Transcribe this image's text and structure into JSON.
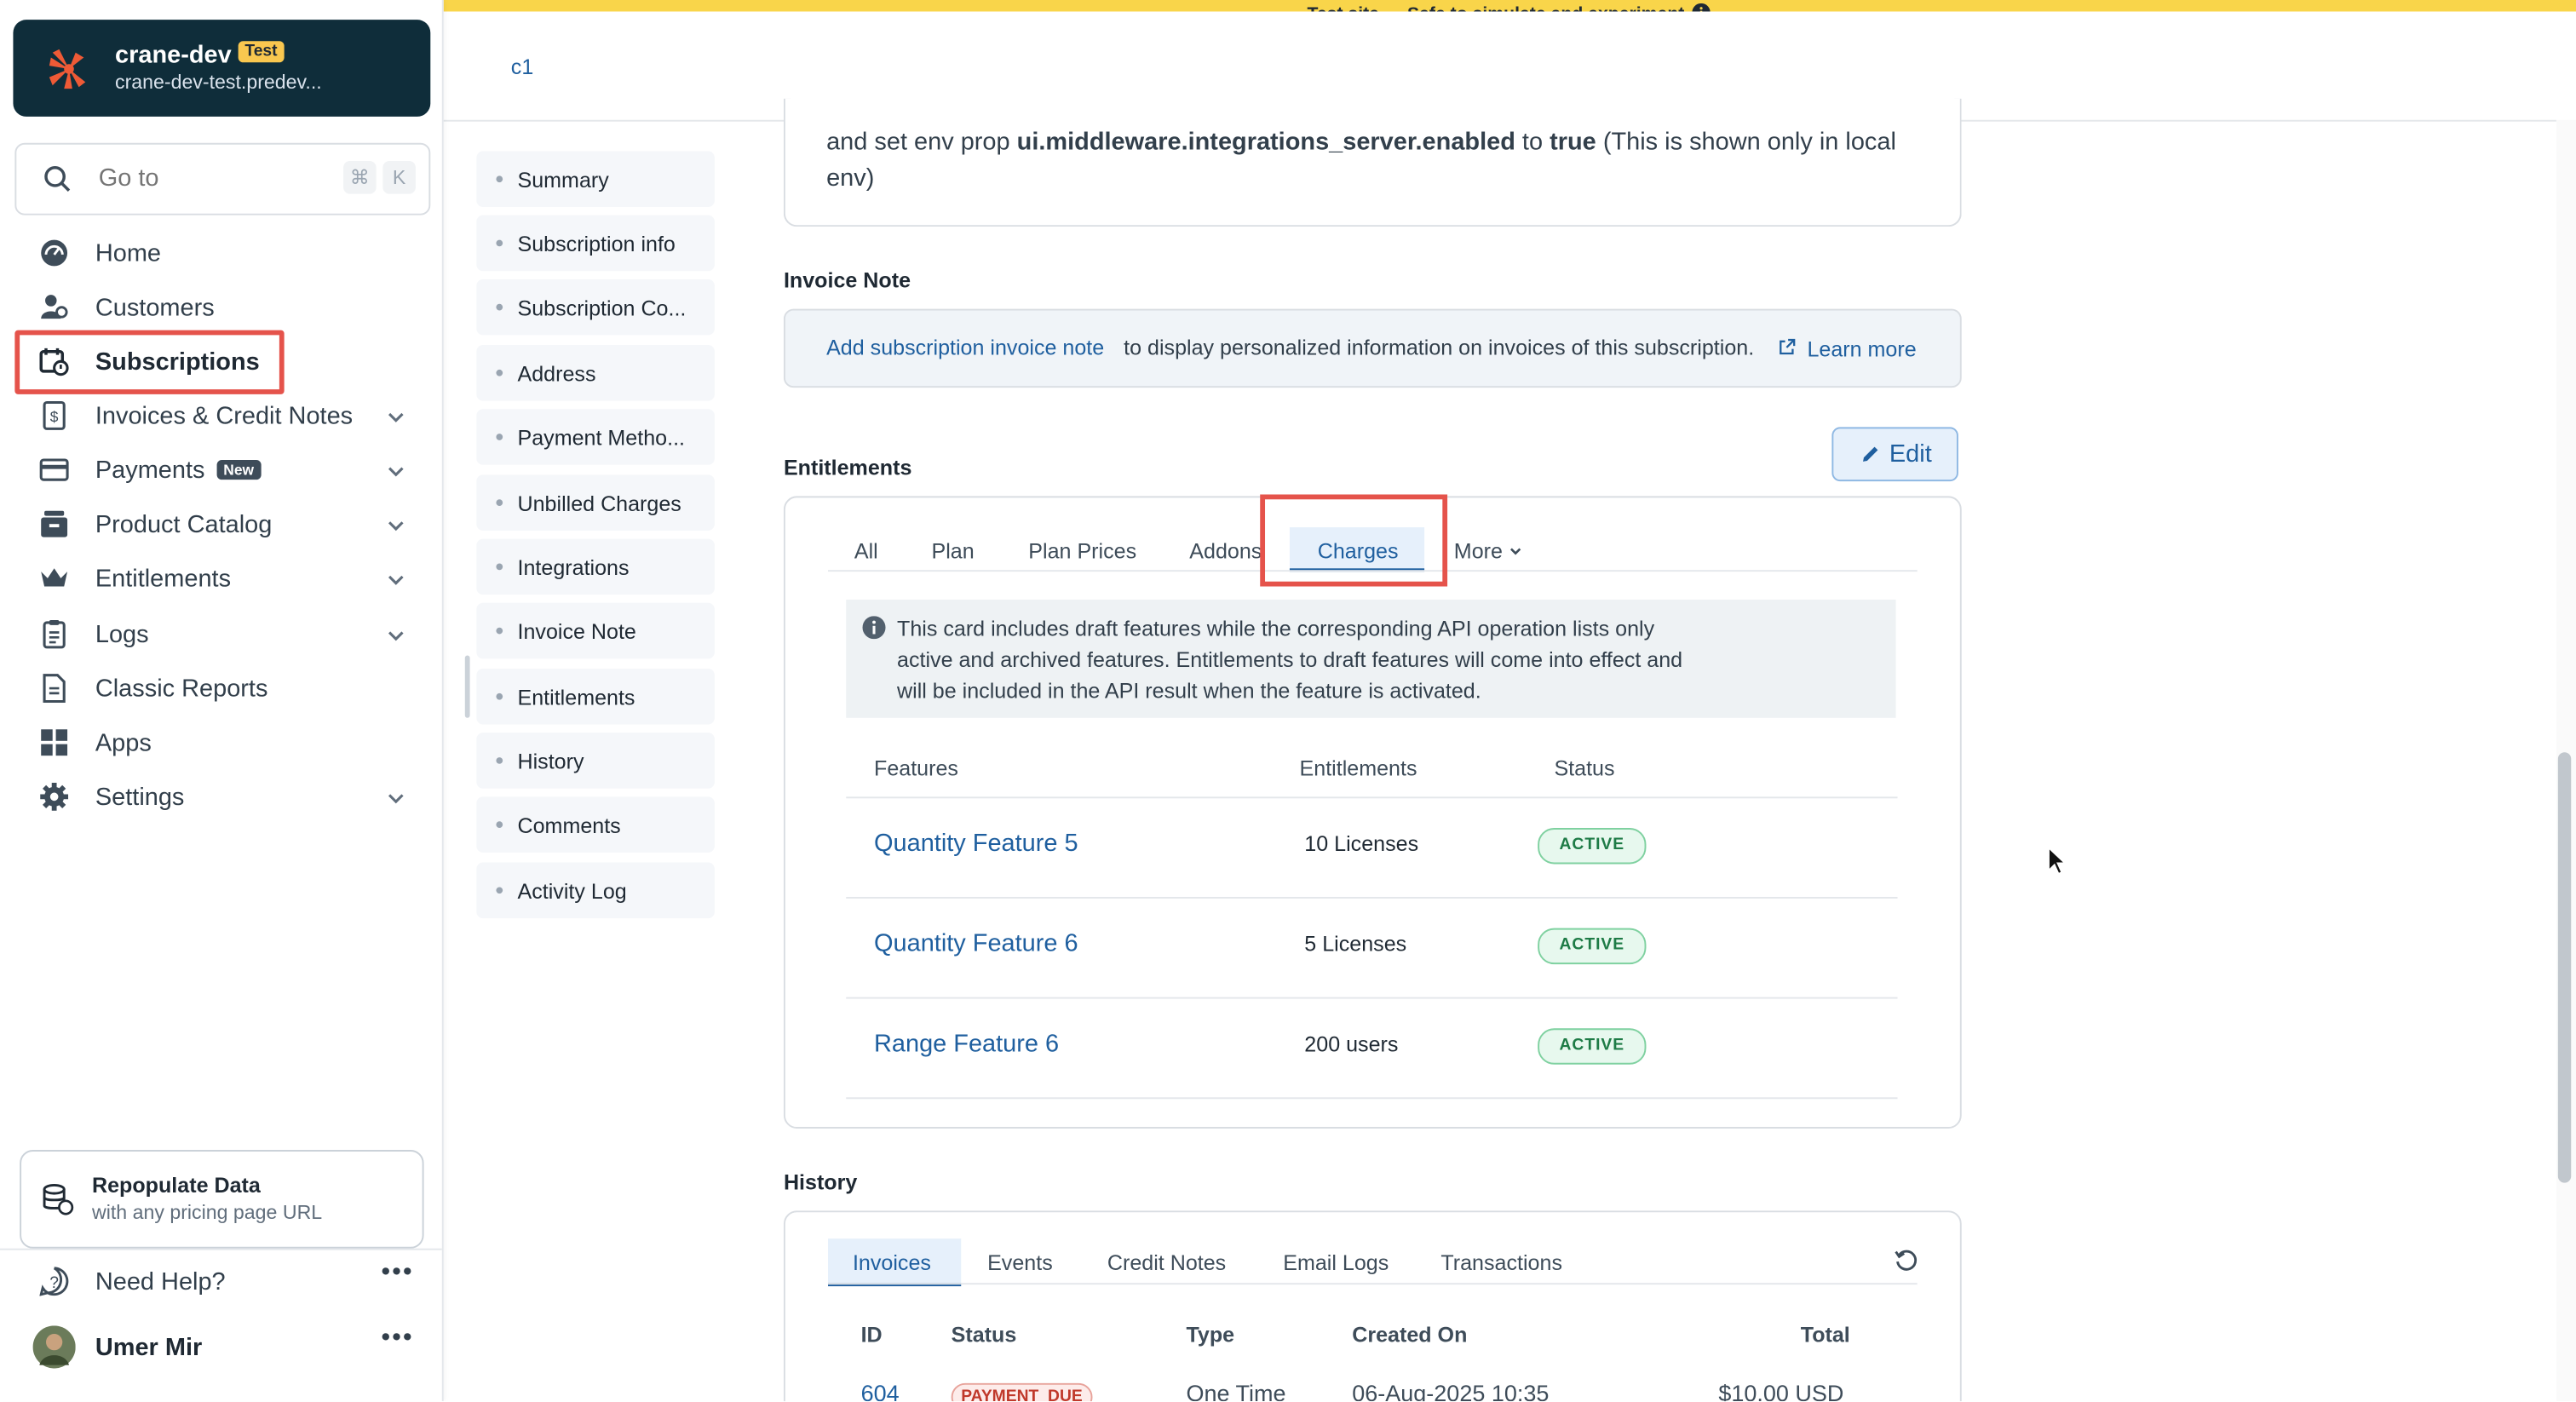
{
  "banner": {
    "text": "Test site — Safe to simulate and experiment"
  },
  "site": {
    "name": "crane-dev",
    "badge": "Test",
    "url": "crane-dev-test.predev..."
  },
  "goto": {
    "placeholder": "Go to",
    "kbd_cmd": "⌘",
    "kbd_k": "K"
  },
  "nav": {
    "items": [
      {
        "label": "Home",
        "icon": "home-icon"
      },
      {
        "label": "Customers",
        "icon": "customers-icon"
      },
      {
        "label": "Subscriptions",
        "icon": "subscriptions-icon",
        "active": true
      },
      {
        "label": "Invoices & Credit Notes",
        "icon": "invoice-icon"
      },
      {
        "label": "Payments",
        "icon": "card-icon",
        "badge": "New"
      },
      {
        "label": "Product Catalog",
        "icon": "catalog-icon"
      },
      {
        "label": "Entitlements",
        "icon": "crown-icon"
      },
      {
        "label": "Logs",
        "icon": "logs-icon"
      },
      {
        "label": "Classic Reports",
        "icon": "report-icon"
      },
      {
        "label": "Apps",
        "icon": "apps-icon"
      },
      {
        "label": "Settings",
        "icon": "gear-icon"
      }
    ]
  },
  "repopulate": {
    "title": "Repopulate Data",
    "subtitle": "with any pricing page URL"
  },
  "help": {
    "label": "Need Help?"
  },
  "user": {
    "name": "Umer Mir"
  },
  "header": {
    "crumb": "c1"
  },
  "sections": [
    "Summary",
    "Subscription info",
    "Subscription Co...",
    "Address",
    "Payment Metho...",
    "Unbilled Charges",
    "Integrations",
    "Invoice Note",
    "Entitlements",
    "History",
    "Comments",
    "Activity Log"
  ],
  "middleware": {
    "pre": "and set env prop ",
    "prop": "ui.middleware.integrations_server.enabled",
    "mid": " to ",
    "val": "true",
    "post": " (This is shown only in local env)"
  },
  "invoice_note": {
    "title": "Invoice Note",
    "link": "Add subscription invoice note",
    "text": "to display personalized information on invoices of this subscription.",
    "learn": "Learn more"
  },
  "entitlements": {
    "title": "Entitlements",
    "edit_label": "Edit",
    "tabs": [
      "All",
      "Plan",
      "Plan Prices",
      "Addons",
      "Charges",
      "More"
    ],
    "active_tab": "Charges",
    "info": "This card includes draft features while the corresponding API operation lists only active and archived features. Entitlements to draft features will come into effect and will be included in the API result when the feature is activated.",
    "columns": [
      "Features",
      "Entitlements",
      "Status"
    ],
    "rows": [
      {
        "feature": "Quantity Feature 5",
        "entitlement": "10 Licenses",
        "status": "ACTIVE"
      },
      {
        "feature": "Quantity Feature 6",
        "entitlement": "5 Licenses",
        "status": "ACTIVE"
      },
      {
        "feature": "Range Feature 6",
        "entitlement": "200 users",
        "status": "ACTIVE"
      }
    ]
  },
  "history": {
    "title": "History",
    "tabs": [
      "Invoices",
      "Events",
      "Credit Notes",
      "Email Logs",
      "Transactions"
    ],
    "columns": [
      "ID",
      "Status",
      "Type",
      "Created On",
      "Total"
    ],
    "rows": [
      {
        "id": "604",
        "status": "PAYMENT_DUE",
        "type": "One Time",
        "created": "06-Aug-2025 10:35",
        "total": "$10.00 USD"
      }
    ]
  },
  "colors": {
    "accent": "#1f5f9f",
    "highlight": "#e5534b",
    "banner": "#f9d54a",
    "sidebar_card": "#0f2d3a"
  }
}
